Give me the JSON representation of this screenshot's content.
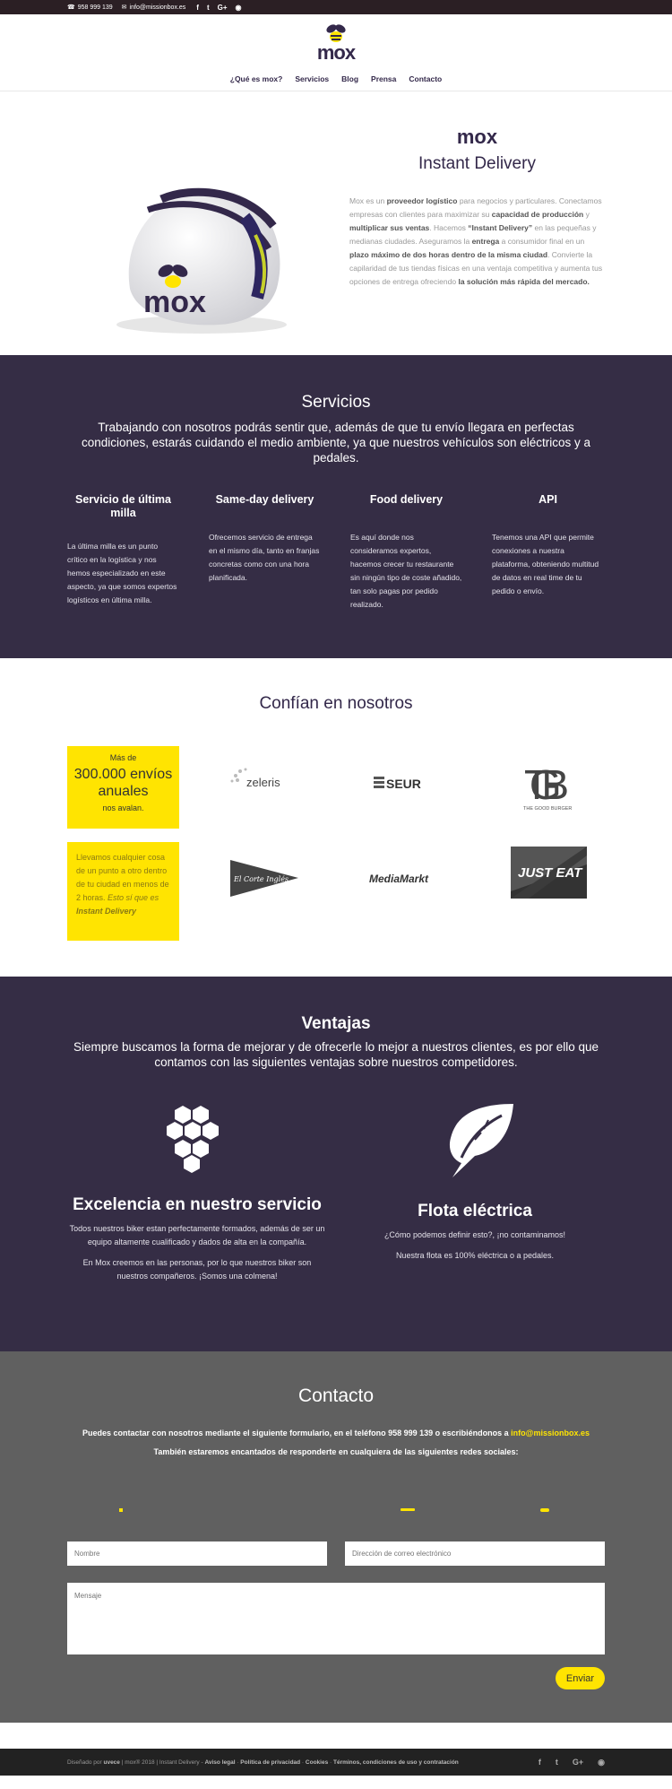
{
  "topbar": {
    "phone": "958 999 139",
    "email": "info@missionbox.es",
    "social": [
      "f",
      "t",
      "G+",
      "rss"
    ]
  },
  "header": {
    "logo_text": "mox",
    "nav": [
      "¿Qué es mox?",
      "Servicios",
      "Blog",
      "Prensa",
      "Contacto"
    ]
  },
  "intro": {
    "title": "mox",
    "subtitle": "Instant Delivery",
    "helmet_brand": "mox",
    "paragraph": [
      {
        "t": "Mox es un ",
        "b": false
      },
      {
        "t": "proveedor logístico",
        "b": true
      },
      {
        "t": " para negocios y particulares. Conectamos empresas con clientes para maximizar su ",
        "b": false
      },
      {
        "t": "capacidad de producción",
        "b": true
      },
      {
        "t": " y ",
        "b": false
      },
      {
        "t": "multiplicar sus ventas",
        "b": true
      },
      {
        "t": ". Hacemos ",
        "b": false
      },
      {
        "t": "“Instant Delivery”",
        "b": true
      },
      {
        "t": " en las pequeñas y medianas ciudades. Aseguramos la ",
        "b": false
      },
      {
        "t": "entrega",
        "b": true
      },
      {
        "t": " a consumidor final en un ",
        "b": false
      },
      {
        "t": "plazo máximo de dos horas dentro de la misma ciudad",
        "b": true
      },
      {
        "t": ". Convierte la capilaridad de tus tiendas físicas en una ventaja competitiva y aumenta tus opciones de entrega ofreciendo ",
        "b": false
      },
      {
        "t": "la solución más rápida del mercado.",
        "b": true
      }
    ]
  },
  "servicios": {
    "title": "Servicios",
    "subtitle": "Trabajando con nosotros podrás sentir que, además de que tu envío llegara en perfectas condiciones, estarás cuidando el medio ambiente, ya que nuestros vehículos son eléctricos y a pedales.",
    "items": [
      {
        "title": "Servicio de última milla",
        "text": "La última milla es un punto crítico en la logística y nos hemos especializado en este aspecto, ya que somos expertos logísticos en última milla."
      },
      {
        "title": "Same-day delivery",
        "text": "Ofrecemos servicio de entrega en el mismo día, tanto en franjas concretas como con una hora planificada."
      },
      {
        "title": "Food delivery",
        "text": "Es aquí donde nos consideramos expertos, hacemos crecer tu restaurante sin ningún tipo de coste añadido, tan solo pagas por pedido realizado."
      },
      {
        "title": "API",
        "text": "Tenemos una API que permite conexiones a nuestra plataforma, obteniendo multitud de datos en real time de tu pedido o envío."
      }
    ]
  },
  "confian": {
    "title": "Confían en nosotros",
    "stat_prefix": "Más de",
    "stat_value": "300.000 envíos anuales",
    "stat_suffix": "nos avalan.",
    "promo_text": "Llevamos cualquier cosa de un punto a otro dentro de tu ciudad en menos de 2 horas. ",
    "promo_italic": "Esto sí que es ",
    "promo_bold": "Instant Delivery",
    "brands": {
      "zeleris": "zeleris",
      "seur": "SEUR",
      "tgb": "TGB",
      "tgb_sub": "THE GOOD BURGER",
      "corte": "El Corte Inglés",
      "mediamarkt": "MediaMarkt",
      "justeat": "JUST EAT"
    }
  },
  "ventajas": {
    "title": "Ventajas",
    "subtitle": "Siempre buscamos la forma de mejorar y de ofrecerle lo mejor a nuestros clientes, es por ello que contamos con las siguientes ventajas sobre nuestros competidores.",
    "col1": {
      "title": "Excelencia en nuestro servicio",
      "p1": "Todos nuestros biker estan perfectamente formados, además de ser un equipo altamente cualificado y dados de alta en la compañía.",
      "p2": "En Mox creemos en las personas, por lo que nuestros biker son nuestros compañeros. ¡Somos una colmena!"
    },
    "col2": {
      "title": "Flota eléctrica",
      "p1": "¿Cómo podemos definir esto?, ¡no contaminamos!",
      "p2": "Nuestra flota es 100% eléctrica o a pedales."
    }
  },
  "contacto": {
    "title": "Contacto",
    "line1": "Puedes contactar con nosotros mediante el siguiente formulario, en el teléfono 958 999 139 o escribiéndonos a ",
    "email": "info@missionbox.es",
    "line2": "También estaremos encantados de responderte en cualquiera de las siguientes redes sociales:",
    "name_placeholder": "Nombre",
    "email_placeholder": "Dirección de correo electrónico",
    "message_placeholder": "Mensaje",
    "send": "Enviar"
  },
  "footer": {
    "designed_by": "Diseñado por ",
    "designer": "uvece",
    "copy": " | mox® 2018 | Instant Delivery - ",
    "links": [
      "Aviso legal",
      "Política de privacidad",
      "Cookies",
      "Términos, condiciones de uso y contratación"
    ],
    "social": [
      "f",
      "t",
      "G+",
      "rss"
    ]
  },
  "colors": {
    "purple": "#352d45",
    "yellow": "#ffe401",
    "gray": "#606060",
    "dark": "#222222"
  }
}
